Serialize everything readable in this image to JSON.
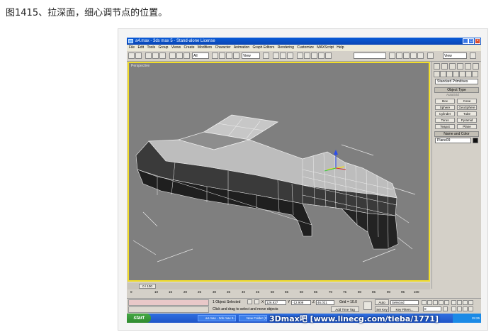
{
  "caption": "图1415、拉深面，细心调节点的位置。",
  "app": {
    "title": "a4.max - 3ds max 5 - Stand-alone License",
    "menu": [
      "File",
      "Edit",
      "Tools",
      "Group",
      "Views",
      "Create",
      "Modifiers",
      "Character",
      "Animation",
      "Graph Editors",
      "Rendering",
      "Customize",
      "MAXScript",
      "Help"
    ],
    "toolbar": {
      "filter_value": "All",
      "view_value": "View",
      "view_value2": "View"
    },
    "viewport": {
      "label": "Perspective"
    },
    "command_panel": {
      "category_value": "Standard Primitives",
      "object_type_title": "Object Type",
      "autogrid_label": "AutoGrid",
      "primitives": [
        "Box",
        "Cone",
        "Sphere",
        "GeoSphere",
        "Cylinder",
        "Tube",
        "Torus",
        "Pyramid",
        "Teapot",
        "Plane"
      ],
      "name_color_title": "Name and Color",
      "object_name": "Plane09",
      "object_color": "#111111"
    },
    "timeline": {
      "slider_text": "0 / 100",
      "ticks": [
        "0",
        "10",
        "15",
        "20",
        "25",
        "30",
        "35",
        "40",
        "45",
        "50",
        "55",
        "60",
        "65",
        "70",
        "75",
        "80",
        "85",
        "90",
        "95",
        "100"
      ]
    },
    "status": {
      "selection": "1 Object Selected",
      "prompt": "Click and drag to select and move objects",
      "x_label": "X",
      "x_value": "126.927",
      "y_label": "Y",
      "y_value": "-12.909",
      "z_label": "Z",
      "z_value": "46.021",
      "grid": "Grid = 10.0",
      "add_time_tag": "Add Time Tag",
      "auto_key": "Auto Key",
      "selected_value": "Selected",
      "set_key": "Set Key",
      "key_filters": "Key Filters...",
      "frame_value": "0"
    },
    "taskbar": {
      "start_label": "start",
      "items": [
        "a4.max - 3ds max 5 -...",
        "New Folder (2)"
      ],
      "clock": "15:26"
    }
  },
  "watermark": "3Dmax吧  [www.linecg.com/tieba/1771]"
}
